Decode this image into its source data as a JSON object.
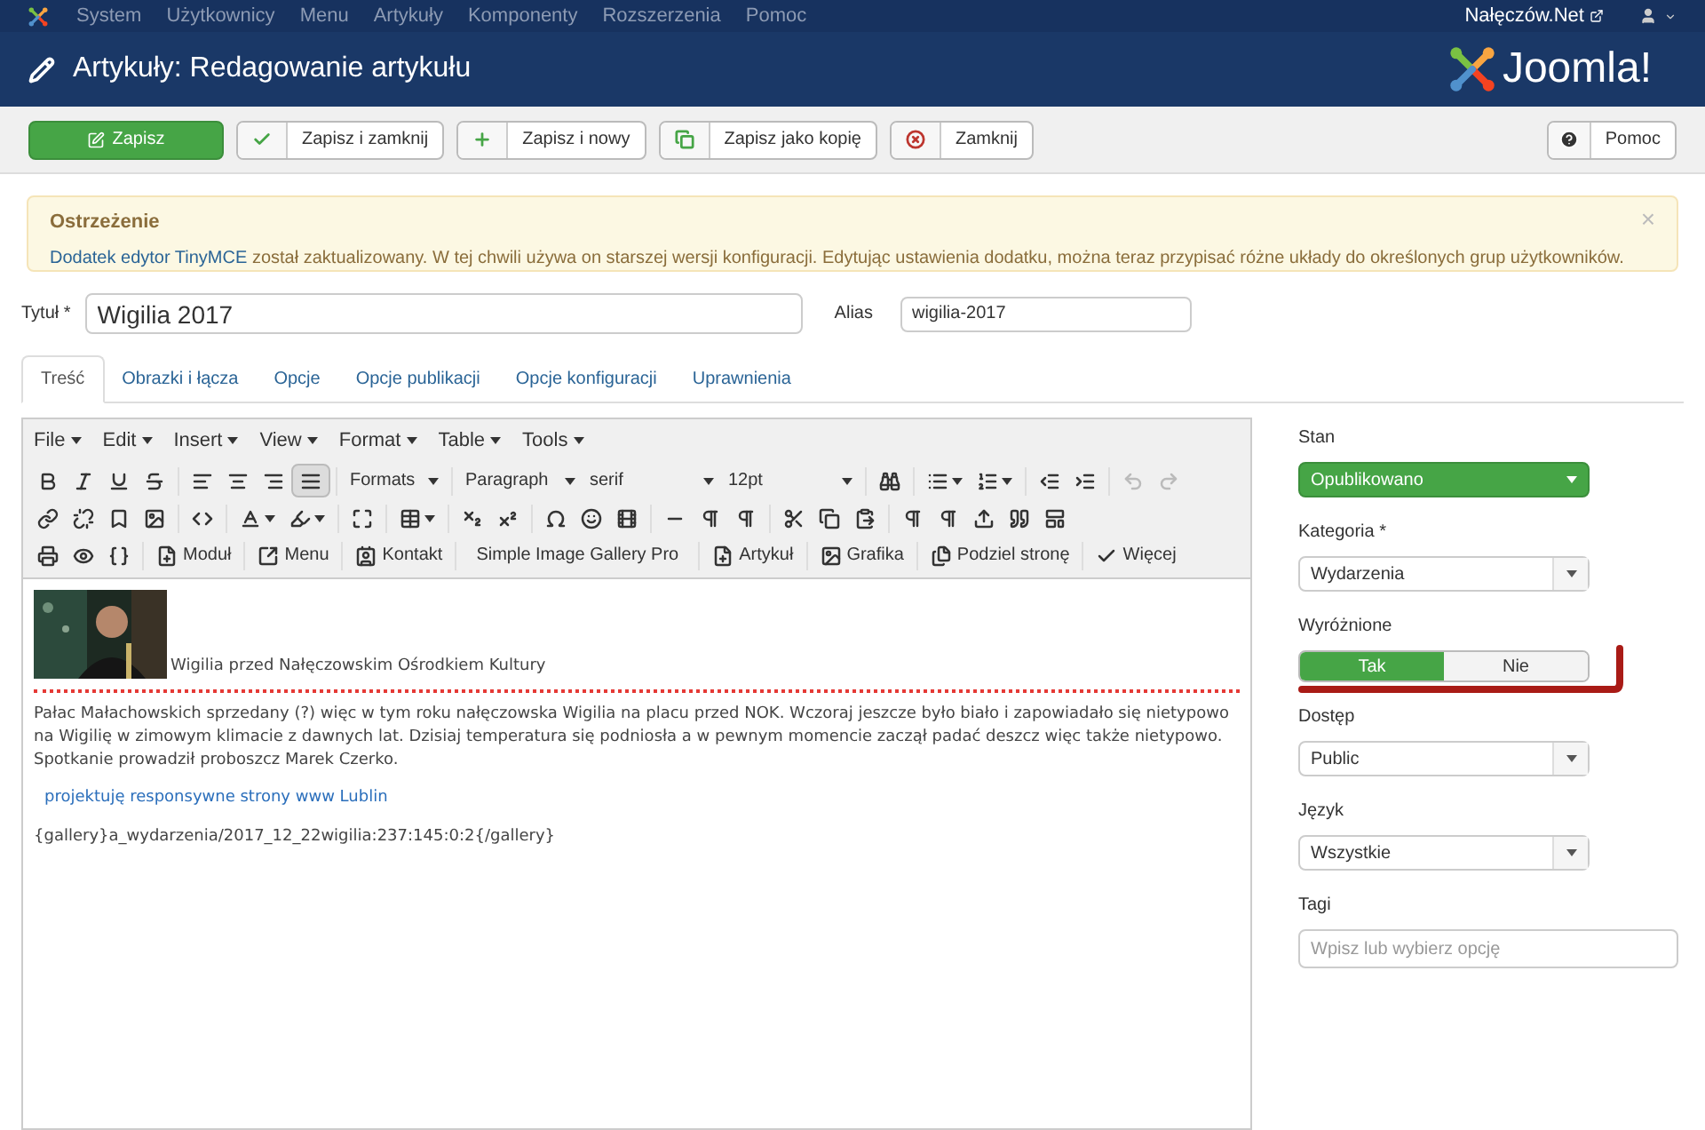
{
  "top_menu": {
    "items": [
      "System",
      "Użytkownicy",
      "Menu",
      "Artykuły",
      "Komponenty",
      "Rozszerzenia",
      "Pomoc"
    ],
    "site_link": "Nałęczów.Net"
  },
  "header": {
    "title": "Artykuły: Redagowanie artykułu",
    "logo_text": "Joomla!"
  },
  "actions": [
    {
      "kind": "save",
      "label": "Zapisz"
    },
    {
      "kind": "check",
      "label": "Zapisz i zamknij"
    },
    {
      "kind": "plus",
      "label": "Zapisz i nowy"
    },
    {
      "kind": "copy",
      "label": "Zapisz jako kopię"
    },
    {
      "kind": "close",
      "label": "Zamknij"
    }
  ],
  "help": {
    "label": "Pomoc"
  },
  "alert": {
    "title": "Ostrzeżenie",
    "link": "Dodatek edytor TinyMCE",
    "message": "został zaktualizowany. W tej chwili używa on starszej wersji konfiguracji. Edytując ustawienia dodatku, można teraz przypisać różne układy do określonych grup użytkowników.",
    "close": "×"
  },
  "title_field": {
    "label": "Tytuł *",
    "value": "Wigilia 2017"
  },
  "alias_field": {
    "label": "Alias",
    "value": "wigilia-2017"
  },
  "tabs": [
    {
      "label": "Treść",
      "selected": true
    },
    {
      "label": "Obrazki i łącza",
      "selected": false
    },
    {
      "label": "Opcje",
      "selected": false
    },
    {
      "label": "Opcje publikacji",
      "selected": false
    },
    {
      "label": "Opcje konfiguracji",
      "selected": false
    },
    {
      "label": "Uprawnienia",
      "selected": false
    }
  ],
  "editor": {
    "menubar": [
      "File",
      "Edit",
      "Insert",
      "View",
      "Format",
      "Table",
      "Tools"
    ],
    "toolbar_rows": [
      [
        {
          "kind": "icon",
          "selected": false,
          "disabled": false
        },
        {
          "kind": "icon",
          "selected": false,
          "disabled": false
        },
        {
          "kind": "icon",
          "selected": false,
          "disabled": false
        },
        {
          "kind": "icon",
          "selected": false,
          "disabled": false
        },
        {
          "kind": "sep"
        },
        {
          "kind": "icon",
          "selected": false,
          "disabled": false
        },
        {
          "kind": "icon",
          "selected": false,
          "disabled": false
        },
        {
          "kind": "icon",
          "selected": false,
          "disabled": false
        },
        {
          "kind": "icon",
          "selected": true,
          "disabled": false
        },
        {
          "kind": "sep"
        },
        {
          "kind": "dropdown",
          "label": "Formats"
        },
        {
          "kind": "sep"
        },
        {
          "kind": "dropdown",
          "label": "Paragraph"
        },
        {
          "kind": "dropdown",
          "label": "serif"
        },
        {
          "kind": "dropdown",
          "label": "12pt"
        },
        {
          "kind": "sep"
        },
        {
          "kind": "icon",
          "selected": false,
          "disabled": false
        },
        {
          "kind": "sep"
        },
        {
          "kind": "split",
          "selected": false,
          "disabled": false
        },
        {
          "kind": "split",
          "selected": false,
          "disabled": false
        },
        {
          "kind": "sep"
        },
        {
          "kind": "icon",
          "selected": false,
          "disabled": false
        },
        {
          "kind": "icon",
          "selected": false,
          "disabled": false
        },
        {
          "kind": "sep"
        },
        {
          "kind": "icon",
          "selected": false,
          "disabled": true
        },
        {
          "kind": "icon",
          "selected": false,
          "disabled": true
        }
      ],
      [
        {
          "kind": "icon",
          "selected": false,
          "disabled": false
        },
        {
          "kind": "icon",
          "selected": false,
          "disabled": false
        },
        {
          "kind": "icon",
          "selected": false,
          "disabled": false
        },
        {
          "kind": "icon",
          "selected": false,
          "disabled": false
        },
        {
          "kind": "sep"
        },
        {
          "kind": "icon",
          "selected": false,
          "disabled": false
        },
        {
          "kind": "sep"
        },
        {
          "kind": "split",
          "selected": false,
          "disabled": false
        },
        {
          "kind": "split",
          "selected": false,
          "disabled": false
        },
        {
          "kind": "sep"
        },
        {
          "kind": "icon",
          "selected": false,
          "disabled": false
        },
        {
          "kind": "sep"
        },
        {
          "kind": "split",
          "selected": false,
          "disabled": false
        },
        {
          "kind": "sep"
        },
        {
          "kind": "icon",
          "selected": false,
          "disabled": false
        },
        {
          "kind": "icon",
          "selected": false,
          "disabled": false
        },
        {
          "kind": "sep"
        },
        {
          "kind": "icon",
          "selected": false,
          "disabled": false
        },
        {
          "kind": "icon",
          "selected": false,
          "disabled": false
        },
        {
          "kind": "icon",
          "selected": false,
          "disabled": false
        },
        {
          "kind": "sep"
        },
        {
          "kind": "icon",
          "selected": false,
          "disabled": false
        },
        {
          "kind": "icon",
          "selected": false,
          "disabled": false
        },
        {
          "kind": "icon",
          "selected": false,
          "disabled": false
        },
        {
          "kind": "sep"
        },
        {
          "kind": "icon",
          "selected": false,
          "disabled": false
        },
        {
          "kind": "icon",
          "selected": false,
          "disabled": false
        },
        {
          "kind": "icon",
          "selected": false,
          "disabled": false
        },
        {
          "kind": "sep"
        },
        {
          "kind": "icon",
          "selected": false,
          "disabled": false
        },
        {
          "kind": "icon",
          "selected": false,
          "disabled": false
        },
        {
          "kind": "icon",
          "selected": false,
          "disabled": false
        },
        {
          "kind": "icon",
          "selected": false,
          "disabled": false
        },
        {
          "kind": "icon",
          "selected": false,
          "disabled": false
        }
      ],
      [
        {
          "kind": "icon",
          "selected": false,
          "disabled": false
        },
        {
          "kind": "icon",
          "selected": false,
          "disabled": false
        },
        {
          "kind": "icon",
          "selected": false,
          "disabled": false
        },
        {
          "kind": "sep"
        },
        {
          "kind": "labeled",
          "label": "Moduł"
        },
        {
          "kind": "sep"
        },
        {
          "kind": "labeled",
          "label": "Menu"
        },
        {
          "kind": "sep"
        },
        {
          "kind": "labeled",
          "label": "Kontakt"
        },
        {
          "kind": "sep"
        },
        {
          "kind": "text",
          "label": "Simple Image Gallery Pro"
        },
        {
          "kind": "sep"
        },
        {
          "kind": "labeled",
          "label": "Artykuł"
        },
        {
          "kind": "sep"
        },
        {
          "kind": "labeled",
          "label": "Grafika"
        },
        {
          "kind": "sep"
        },
        {
          "kind": "labeled",
          "label": "Podziel stronę"
        },
        {
          "kind": "sep"
        },
        {
          "kind": "labeled",
          "label": "Więcej"
        }
      ]
    ],
    "content": {
      "image_caption": "Wigilia przed Nałęczowskim Ośrodkiem Kultury",
      "paragraph": "Pałac Małachowskich sprzedany (?) więc w tym roku nałęczowska Wigilia na placu przed NOK. Wczoraj jeszcze było biało i zapowiadało się nietypowo na Wigilię w zimowym klimacie z dawnych lat. Dzisiaj temperatura się podniosła a w pewnym momencie zaczął padać deszcz więc także nietypowo. Spotkanie prowadził proboszcz Marek Czerko.",
      "link": "projektuję responsywne strony www Lublin",
      "code": "{gallery}a_wydarzenia/2017_12_22wigilia:237:145:0:2{/gallery}"
    }
  },
  "sidebar": {
    "fields": [
      {
        "kind": "status",
        "label": "Stan",
        "value": "Opublikowano"
      },
      {
        "kind": "select",
        "label": "Kategoria *",
        "value": "Wydarzenia"
      },
      {
        "kind": "toggle",
        "label": "Wyróżnione",
        "options": [
          {
            "label": "Tak",
            "selected": true
          },
          {
            "label": "Nie",
            "selected": false
          }
        ],
        "annotated": true
      },
      {
        "kind": "select",
        "label": "Dostęp",
        "value": "Public"
      },
      {
        "kind": "select",
        "label": "Język",
        "value": "Wszystkie"
      },
      {
        "kind": "tags",
        "label": "Tagi",
        "placeholder": "Wpisz lub wybierz opcję"
      }
    ]
  }
}
